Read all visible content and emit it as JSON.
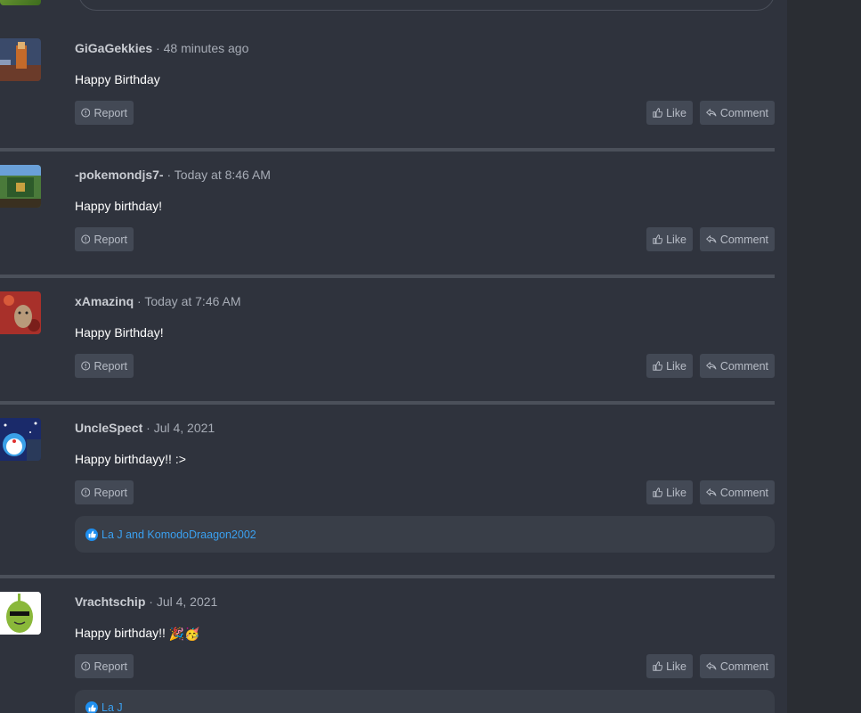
{
  "posts": [
    {
      "username": "GiGaGekkies",
      "time": "48 minutes ago",
      "message": "Happy Birthday",
      "report_label": "Report",
      "like_label": "Like",
      "comment_label": "Comment"
    },
    {
      "username": "-pokemondjs7-",
      "time": "Today at 8:46 AM",
      "message": "Happy birthday!",
      "report_label": "Report",
      "like_label": "Like",
      "comment_label": "Comment"
    },
    {
      "username": "xAmazinq",
      "time": "Today at 7:46 AM",
      "message": "Happy Birthday!",
      "report_label": "Report",
      "like_label": "Like",
      "comment_label": "Comment"
    },
    {
      "username": "UncleSpect",
      "time": "Jul 4, 2021",
      "message": "Happy birthdayy!! :>",
      "report_label": "Report",
      "like_label": "Like",
      "comment_label": "Comment",
      "reactions": "La J and KomodoDraagon2002"
    },
    {
      "username": "Vrachtschip",
      "time": "Jul 4, 2021",
      "message": "Happy birthday!!",
      "message_emoji": "🎉🥳",
      "report_label": "Report",
      "like_label": "Like",
      "comment_label": "Comment",
      "reactions": "La J"
    }
  ],
  "separator": " · ",
  "colors": {
    "background": "#2f333d",
    "button": "#434955",
    "reaction_link": "#3aa0f0",
    "divider": "#4b505a"
  }
}
